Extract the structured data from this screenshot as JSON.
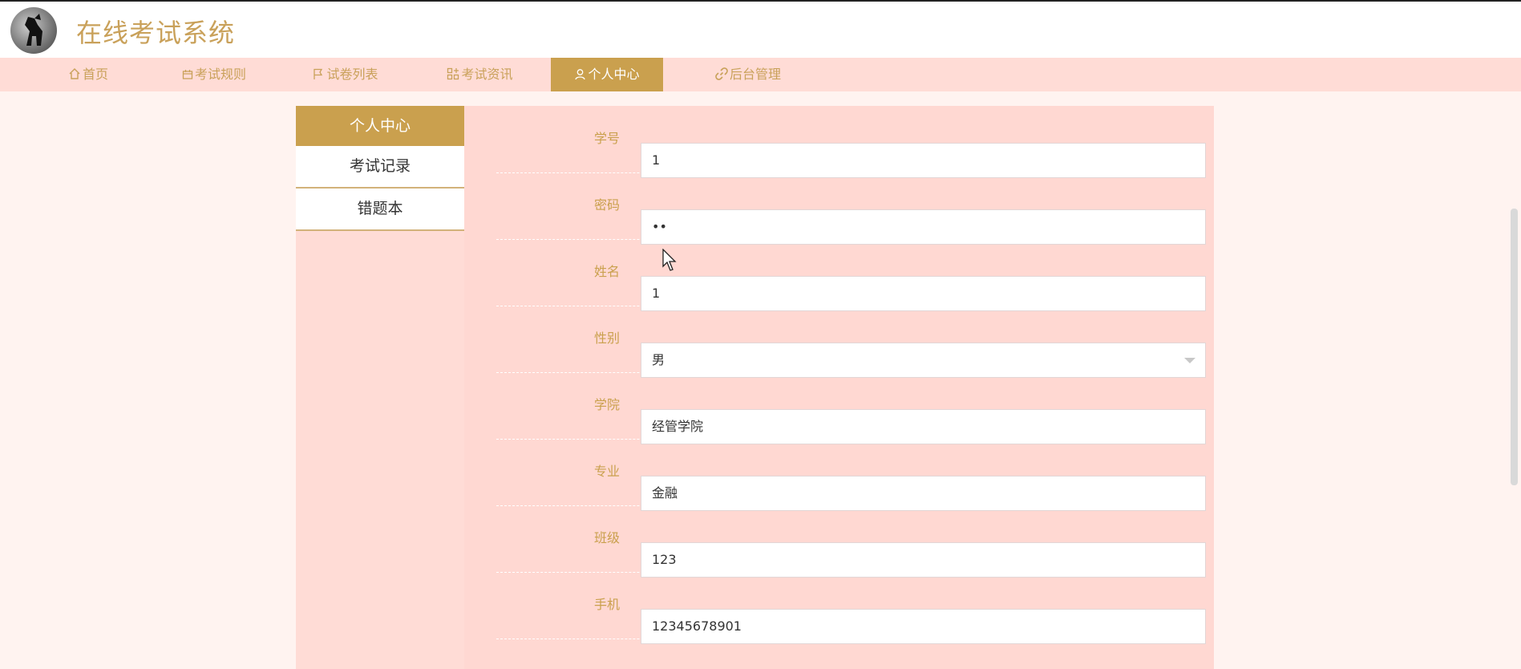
{
  "header": {
    "site_title": "在线考试系统",
    "logo_icon": "dog-silhouette-logo"
  },
  "nav": {
    "items": [
      {
        "label": "首页",
        "icon": "home-icon"
      },
      {
        "label": "考试规则",
        "icon": "calendar-icon"
      },
      {
        "label": "试卷列表",
        "icon": "flag-icon"
      },
      {
        "label": "考试资讯",
        "icon": "news-icon"
      },
      {
        "label": "个人中心",
        "icon": "user-icon",
        "active": true
      },
      {
        "label": "后台管理",
        "icon": "link-icon"
      }
    ]
  },
  "sidebar": {
    "title": "个人中心",
    "items": [
      {
        "label": "考试记录"
      },
      {
        "label": "错题本"
      }
    ]
  },
  "form": {
    "fields": [
      {
        "label": "学号",
        "value": "1"
      },
      {
        "label": "密码",
        "value": "••"
      },
      {
        "label": "姓名",
        "value": "1"
      },
      {
        "label": "性别",
        "value": "男"
      },
      {
        "label": "学院",
        "value": "经管学院"
      },
      {
        "label": "专业",
        "value": "金融"
      },
      {
        "label": "班级",
        "value": "123"
      },
      {
        "label": "手机",
        "value": "12345678901"
      }
    ]
  },
  "colors": {
    "accent": "#caa04e",
    "nav_bg": "#ffdcd6",
    "panel_bg": "#ffd8d2",
    "page_bg": "#fff3f0"
  }
}
